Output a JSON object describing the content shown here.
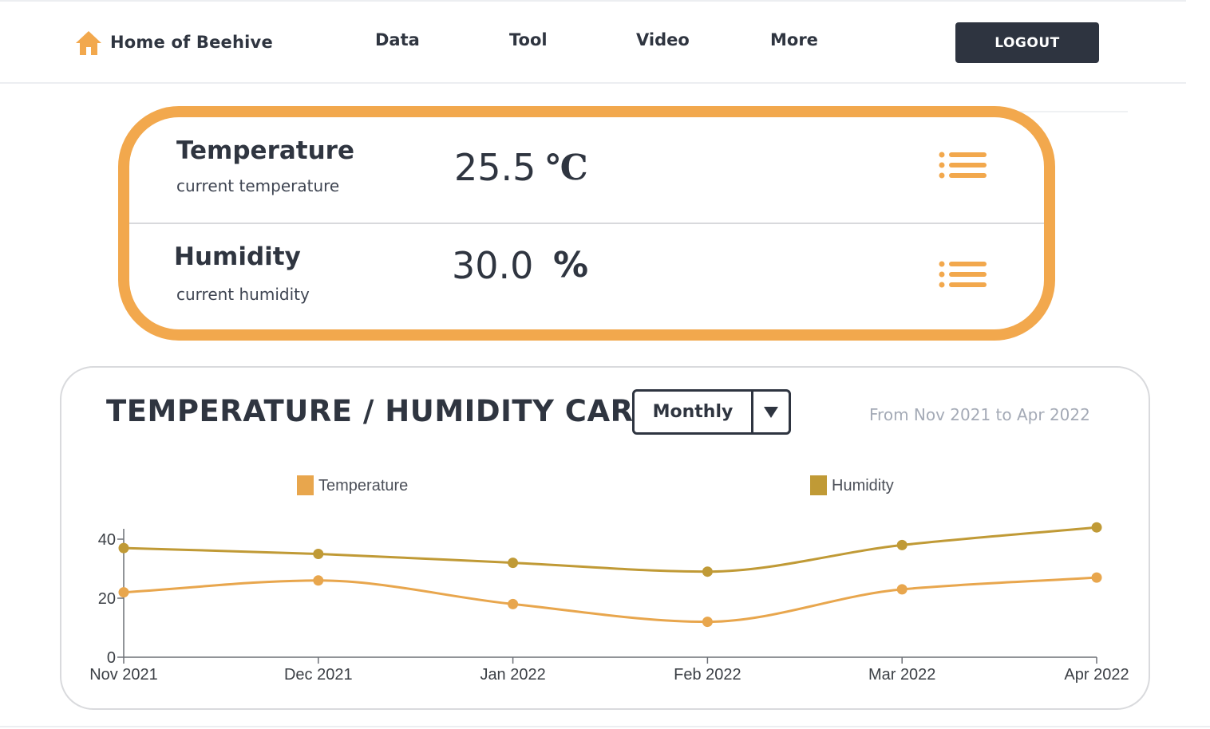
{
  "nav": {
    "brand": "Home of Beehive",
    "links": [
      "Data",
      "Tool",
      "Video",
      "More"
    ],
    "logout_label": "LOGOUT"
  },
  "readings": {
    "temperature": {
      "title": "Temperature",
      "subtitle": "current temperature",
      "value": "25.5",
      "unit": "℃"
    },
    "humidity": {
      "title": "Humidity",
      "subtitle": "current humidity",
      "value": "30.0",
      "unit": "%"
    },
    "menu_icon": "list-icon"
  },
  "chart_section": {
    "title": "TEMPERATURE / HUMIDITY CARVE",
    "period_selected": "Monthly",
    "range_text": "From Nov 2021 to Apr 2022"
  },
  "colors": {
    "accent": "#f2a84d",
    "dark": "#2e3440",
    "temperature": "#e8a64d",
    "humidity": "#c09a36"
  },
  "chart_data": {
    "type": "line",
    "categories": [
      "Nov 2021",
      "Dec 2021",
      "Jan 2022",
      "Feb 2022",
      "Mar 2022",
      "Apr 2022"
    ],
    "series": [
      {
        "name": "Temperature",
        "color": "#e8a64d",
        "values": [
          22,
          26,
          18,
          12,
          23,
          27
        ]
      },
      {
        "name": "Humidity",
        "color": "#c09a36",
        "values": [
          37,
          35,
          32,
          29,
          38,
          44
        ]
      }
    ],
    "yticks": [
      "0",
      "20",
      "40"
    ],
    "ylim": [
      0,
      44
    ],
    "legend_position": "top",
    "grid": false,
    "smooth": true
  }
}
